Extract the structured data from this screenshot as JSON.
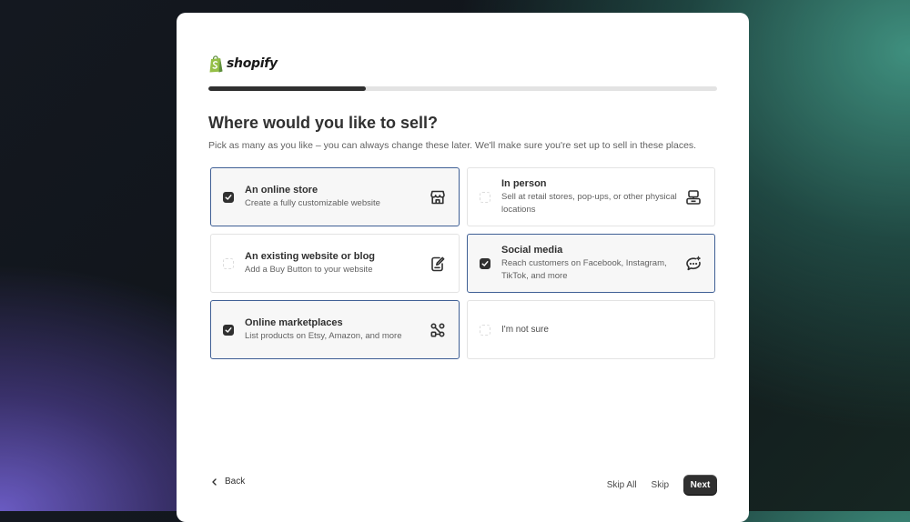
{
  "brand": {
    "name": "shopify",
    "color": "#95bf47"
  },
  "progress": {
    "fraction": 0.31
  },
  "page": {
    "title": "Where would you like to sell?",
    "subtitle": "Pick as many as you like – you can always change these later. We'll make sure you're set up to sell in these places."
  },
  "options": [
    {
      "title": "An online store",
      "description": "Create a fully customizable website",
      "selected": true,
      "icon": "storefront-icon"
    },
    {
      "title": "In person",
      "description": "Sell at retail stores, pop-ups, or other physical locations",
      "selected": false,
      "icon": "pos-terminal-icon"
    },
    {
      "title": "An existing website or blog",
      "description": "Add a Buy Button to your website",
      "selected": false,
      "icon": "edit-document-icon"
    },
    {
      "title": "Social media",
      "description": "Reach customers on Facebook, Instagram, TikTok, and more",
      "selected": true,
      "icon": "chat-sparkle-icon"
    },
    {
      "title": "Online marketplaces",
      "description": "List products on Etsy, Amazon, and more",
      "selected": true,
      "icon": "marketplace-nodes-icon"
    },
    {
      "title": "I'm not sure",
      "description": "",
      "selected": false,
      "icon": ""
    }
  ],
  "footer": {
    "back_label": "Back",
    "skip_all_label": "Skip All",
    "skip_label": "Skip",
    "next_label": "Next"
  },
  "colors": {
    "primary_button": "#303030",
    "selected_border": "#3f5f95"
  }
}
